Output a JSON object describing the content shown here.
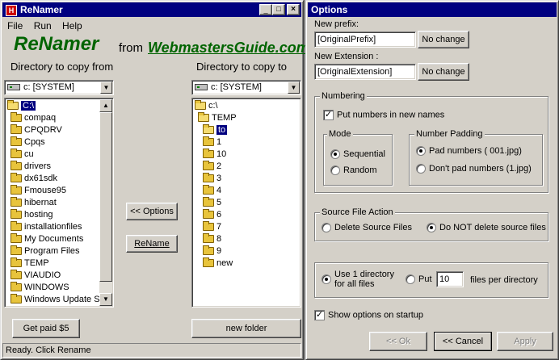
{
  "main": {
    "title": "ReNamer",
    "menu": [
      "File",
      "Run",
      "Help"
    ],
    "brand": "ReNamer",
    "brand_from": "from",
    "brand_site": "WebmastersGuide.com",
    "left_label": "Directory to copy from",
    "right_label": "Directory to copy to",
    "left_drive": "c: [SYSTEM]",
    "right_drive": "c: [SYSTEM]",
    "left_tree": [
      "C:\\",
      "compaq",
      "CPQDRV",
      "Cpqs",
      "cu",
      "drivers",
      "dx61sdk",
      "Fmouse95",
      "hibernat",
      "hosting",
      "installationfiles",
      "My Documents",
      "Program Files",
      "TEMP",
      "VIAUDIO",
      "WINDOWS",
      "Windows Update S"
    ],
    "right_tree": [
      "c:\\",
      "TEMP",
      "to",
      "1",
      "10",
      "2",
      "3",
      "4",
      "5",
      "6",
      "7",
      "8",
      "9",
      "new"
    ],
    "options_button": "<< Options",
    "rename_button": "ReName",
    "getpaid_button": "Get paid $5",
    "newfolder_button": "new folder",
    "status": "Ready. Click Rename"
  },
  "options": {
    "title": "Options",
    "prefix_label": "New prefix:",
    "prefix_value": "[OriginalPrefix]",
    "prefix_btn": "No change",
    "ext_label": "New Extension :",
    "ext_value": "[OriginalExtension]",
    "ext_btn": "No change",
    "numbering_group": "Numbering",
    "put_numbers": "Put numbers in new names",
    "mode_group": "Mode",
    "mode_sequential": "Sequential",
    "mode_random": "Random",
    "padding_group": "Number Padding",
    "pad_yes": "Pad numbers ( 001.jpg)",
    "pad_no": "Don't pad numbers (1.jpg)",
    "source_group": "Source File Action",
    "delete_source": "Delete Source Files",
    "keep_source": "Do NOT delete source files",
    "one_dir_line1": "Use 1 directory",
    "one_dir_line2": "for all files",
    "put_label": "Put",
    "files_per_dir_value": "10",
    "files_per_dir_label": "files per directory",
    "show_options": "Show options on startup",
    "ok_btn": "<< Ok",
    "cancel_btn": "<< Cancel",
    "apply_btn": "Apply"
  },
  "colors": {
    "title_active": "#000080",
    "brand_green": "#006400",
    "selection": "#000080"
  }
}
